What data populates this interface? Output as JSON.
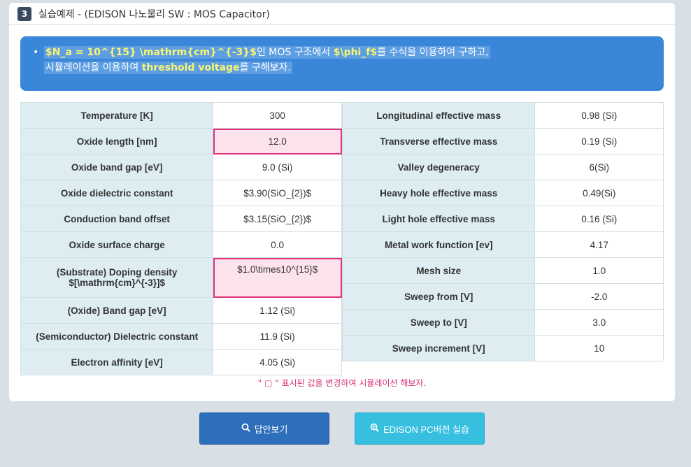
{
  "header": {
    "number": "3",
    "title": "실습예제 - (EDISON 나노물리 SW : MOS Capacitor)"
  },
  "notice": {
    "bullet": "•",
    "line1_hl1": "$N_a = 10^{15} \\mathrm{cm}^{-3}$",
    "line1_t1": "인 MOS 구조에서 ",
    "line1_hl2": "$\\phi_f$",
    "line1_t2": "를 수식을 이용하여 구하고,",
    "line2_t1": "시뮬레이션을 이용하여 ",
    "line2_hl": "threshold voltage",
    "line2_t2": "를 구해보자."
  },
  "left_table": [
    {
      "label": "Temperature [K]",
      "value": "300",
      "editable": false
    },
    {
      "label": "Oxide length [nm]",
      "value": "12.0",
      "editable": true
    },
    {
      "label": "Oxide band gap [eV]",
      "value": "9.0 (Si)",
      "editable": false
    },
    {
      "label": "Oxide dielectric constant",
      "value": "$3.90(SiO_{2})$",
      "editable": false
    },
    {
      "label": "Conduction band offset",
      "value": "$3.15(SiO_{2})$",
      "editable": false
    },
    {
      "label": "Oxide surface charge",
      "value": "0.0",
      "editable": false
    },
    {
      "label": "(Substrate) Doping density",
      "label2": "$[\\mathrm{cm}^{-3}]$",
      "value": "$1.0\\times10^{15}$",
      "editable": true
    },
    {
      "label": "(Oxide) Band gap [eV]",
      "value": "1.12 (Si)",
      "editable": false
    },
    {
      "label": "(Semiconductor) Dielectric constant",
      "value": "11.9 (Si)",
      "editable": false
    },
    {
      "label": "Electron affinity [eV]",
      "value": "4.05 (Si)",
      "editable": false
    }
  ],
  "right_table": [
    {
      "label": "Longitudinal effective mass",
      "value": "0.98 (Si)"
    },
    {
      "label": "Transverse effective mass",
      "value": "0.19 (Si)"
    },
    {
      "label": "Valley degeneracy",
      "value": "6(Si)"
    },
    {
      "label": "Heavy hole effective mass",
      "value": "0.49(Si)"
    },
    {
      "label": "Light hole effective mass",
      "value": "0.16 (Si)"
    },
    {
      "label": "Metal work function [ev]",
      "value": "4.17"
    },
    {
      "label": "Mesh size",
      "value": "1.0"
    },
    {
      "label": "Sweep from [V]",
      "value": "-2.0"
    },
    {
      "label": "Sweep to [V]",
      "value": "3.0"
    },
    {
      "label": "Sweep increment [V]",
      "value": "10"
    }
  ],
  "footnote": "\" ▢ \" 표시된 값을 변경하여 시뮬레이션 해보자.",
  "buttons": {
    "answer_label": "답안보기",
    "pc_label": "EDISON PC버전 실습"
  },
  "colors": {
    "notice_bg": "#3a86d8",
    "highlight": "#f8f570",
    "label_bg": "#ddedf2",
    "editable_border": "#e0337a",
    "answer_button": "#2d6fba",
    "pc_button": "#37bfe0"
  }
}
